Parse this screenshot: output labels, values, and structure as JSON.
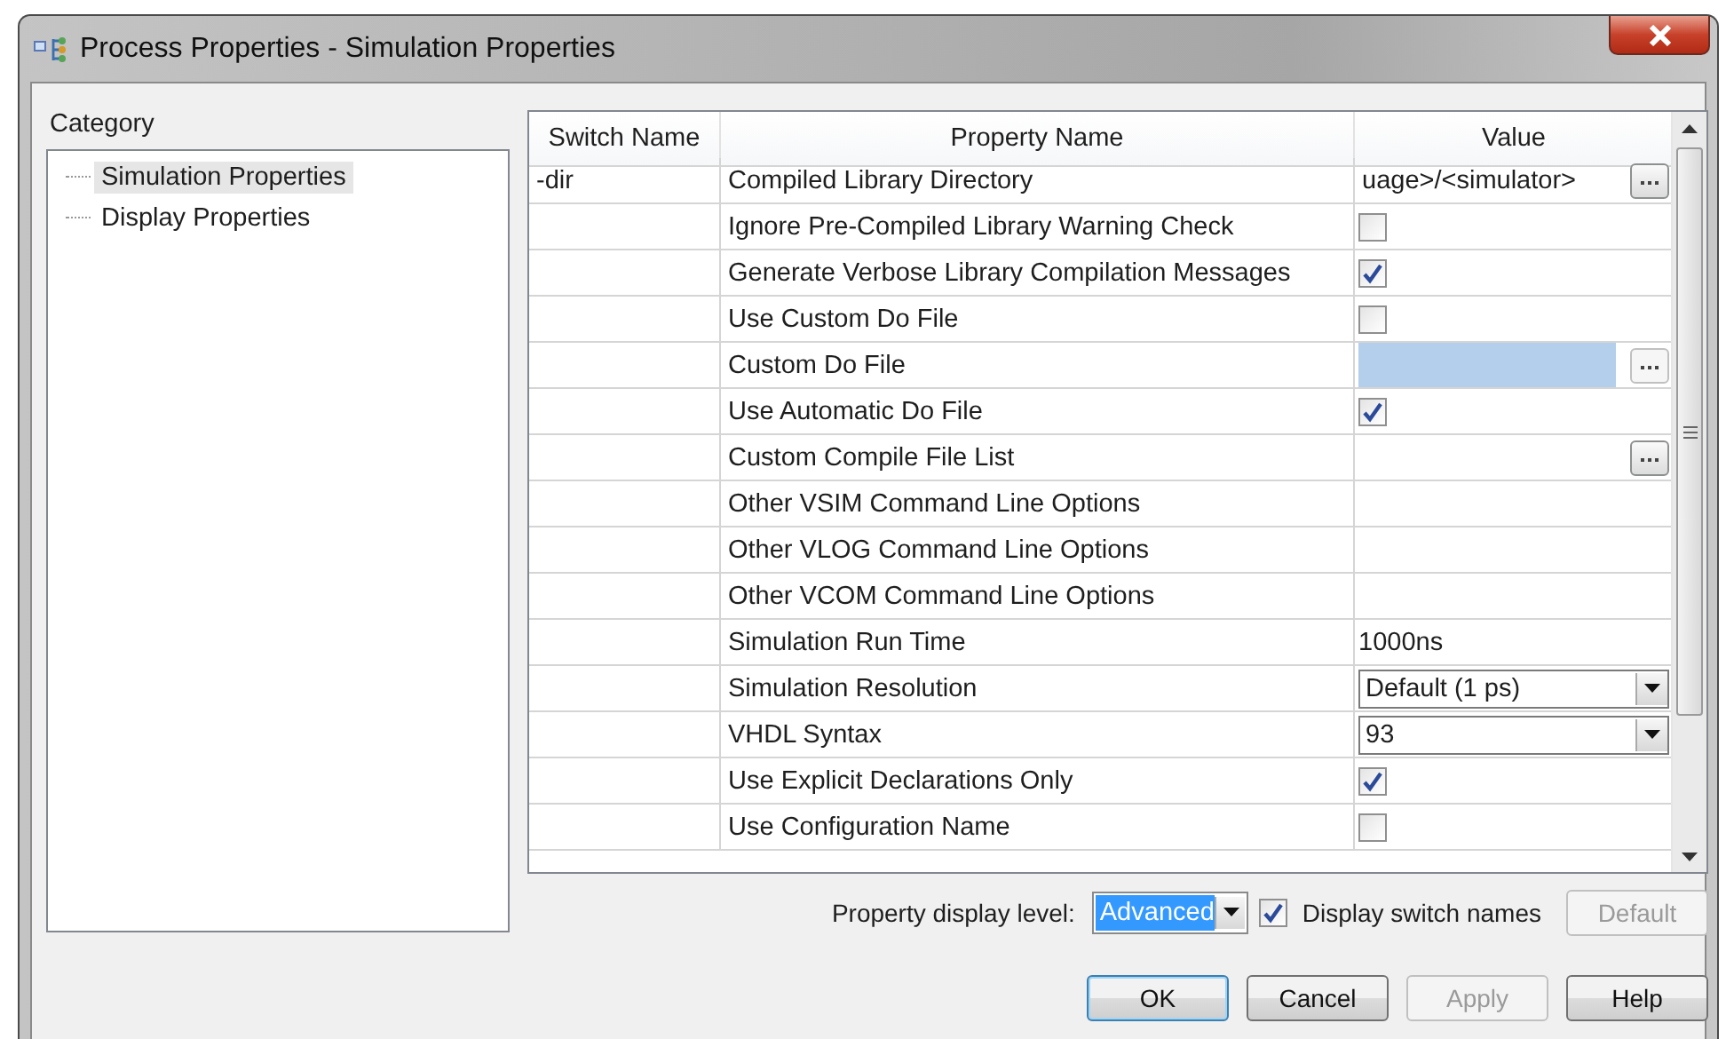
{
  "window": {
    "title": "Process Properties - Simulation Properties"
  },
  "category": {
    "label": "Category",
    "items": [
      {
        "label": "Simulation Properties",
        "selected": true
      },
      {
        "label": "Display Properties",
        "selected": false
      }
    ]
  },
  "table": {
    "columns": [
      "Switch Name",
      "Property Name",
      "Value"
    ],
    "rows": [
      {
        "switch": "-dir",
        "property": "Compiled Library Directory",
        "value": {
          "kind": "browse",
          "text": "uage>/<simulator>"
        }
      },
      {
        "property": "Ignore Pre-Compiled Library Warning Check",
        "value": {
          "kind": "checkbox",
          "checked": false
        }
      },
      {
        "property": "Generate Verbose Library Compilation Messages",
        "value": {
          "kind": "checkbox",
          "checked": true
        }
      },
      {
        "property": "Use Custom Do File",
        "value": {
          "kind": "checkbox",
          "checked": false
        }
      },
      {
        "property": "Custom Do File",
        "value": {
          "kind": "locked-browse"
        }
      },
      {
        "property": "Use Automatic Do File",
        "value": {
          "kind": "checkbox",
          "checked": true
        }
      },
      {
        "property": "Custom Compile File List",
        "value": {
          "kind": "browse"
        }
      },
      {
        "property": "Other VSIM Command Line Options",
        "value": {
          "kind": "text"
        }
      },
      {
        "property": "Other VLOG Command Line Options",
        "value": {
          "kind": "text"
        }
      },
      {
        "property": "Other VCOM Command Line Options",
        "value": {
          "kind": "text"
        }
      },
      {
        "property": "Simulation Run Time",
        "value": {
          "kind": "text",
          "text": "1000ns"
        }
      },
      {
        "property": "Simulation Resolution",
        "value": {
          "kind": "dropdown",
          "text": "Default (1 ps)"
        }
      },
      {
        "property": "VHDL Syntax",
        "value": {
          "kind": "dropdown",
          "text": "93"
        }
      },
      {
        "property": "Use Explicit Declarations Only",
        "value": {
          "kind": "checkbox",
          "checked": true
        }
      },
      {
        "property": "Use Configuration Name",
        "value": {
          "kind": "checkbox",
          "checked": false
        }
      }
    ]
  },
  "footer": {
    "level_label": "Property display level:",
    "level_value": "Advanced",
    "switch_names": {
      "label": "Display switch names",
      "checked": true
    },
    "default_button": {
      "label": "Default",
      "disabled": true
    }
  },
  "buttons": [
    {
      "label": "OK",
      "disabled": false,
      "focused": true
    },
    {
      "label": "Cancel",
      "disabled": false,
      "focused": false
    },
    {
      "label": "Apply",
      "disabled": true,
      "focused": false
    },
    {
      "label": "Help",
      "disabled": false,
      "focused": false
    }
  ]
}
